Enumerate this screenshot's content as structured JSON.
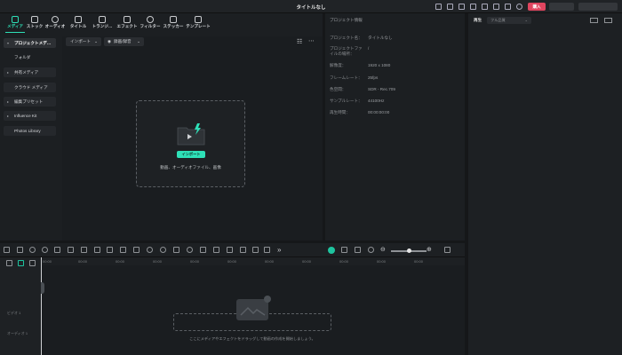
{
  "window": {
    "title": "タイトルなし",
    "buy_label": "購入"
  },
  "media_tabs": [
    {
      "label": "メディア",
      "icon": "media-icon",
      "active": true
    },
    {
      "label": "ストック",
      "icon": "stock-icon"
    },
    {
      "label": "オーディオ",
      "icon": "music-note-icon"
    },
    {
      "label": "タイトル",
      "icon": "text-t-icon"
    },
    {
      "label": "トランジ…",
      "icon": "transition-icon"
    },
    {
      "label": "エフェクト",
      "icon": "effect-icon"
    },
    {
      "label": "フィルター",
      "icon": "filter-icon"
    },
    {
      "label": "ステッカー",
      "icon": "sticker-icon"
    },
    {
      "label": "テンプレート",
      "icon": "template-icon"
    }
  ],
  "sidebar": {
    "items": [
      {
        "label": "プロジェクトメデ…",
        "expanded": true
      },
      {
        "label": "フォルダ"
      },
      {
        "label": "共有メディア"
      },
      {
        "label": "クラウド メディア"
      },
      {
        "label": "編集プリセット"
      },
      {
        "label": "Influence Kit"
      },
      {
        "label": "Photos Library"
      }
    ]
  },
  "media_toolbar": {
    "import_label": "インポート",
    "record_label": "録画/録音"
  },
  "drop_zone": {
    "import_button": "インポート",
    "hint": "動画、オーディオファイル、画像"
  },
  "project_info": {
    "title": "プロジェクト情報",
    "rows": [
      {
        "label": "プロジェクト名：",
        "value": "タイトルなし"
      },
      {
        "label": "プロジェクトファ イルの場所：",
        "value": "/"
      },
      {
        "label": "解像度：",
        "value": "1920 x 1080"
      },
      {
        "label": "フレームレート：",
        "value": "25fps"
      },
      {
        "label": "色空間：",
        "value": "SDR - Rec.709"
      },
      {
        "label": "サンプルレート：",
        "value": "44100Hz"
      },
      {
        "label": "再生時間：",
        "value": "00:00:00:00"
      }
    ]
  },
  "player": {
    "tab_label": "再生",
    "quality": "フル品質"
  },
  "timeline": {
    "ruler_ticks": [
      "00:00",
      "00:00",
      "00:00",
      "00:00",
      "00:00",
      "00:00",
      "00:00",
      "00:00",
      "00:00",
      "00:00",
      "00:00"
    ],
    "track_hint": "ここにメディアやエフェクトをドラッグして動画の作成を開始しましょう。",
    "video_track_label": "ビデオ 1",
    "audio_track_label": "オーディオ 1"
  },
  "colors": {
    "accent": "#2ee0b7",
    "buy": "#e0455f",
    "panel": "#1c1f22"
  }
}
